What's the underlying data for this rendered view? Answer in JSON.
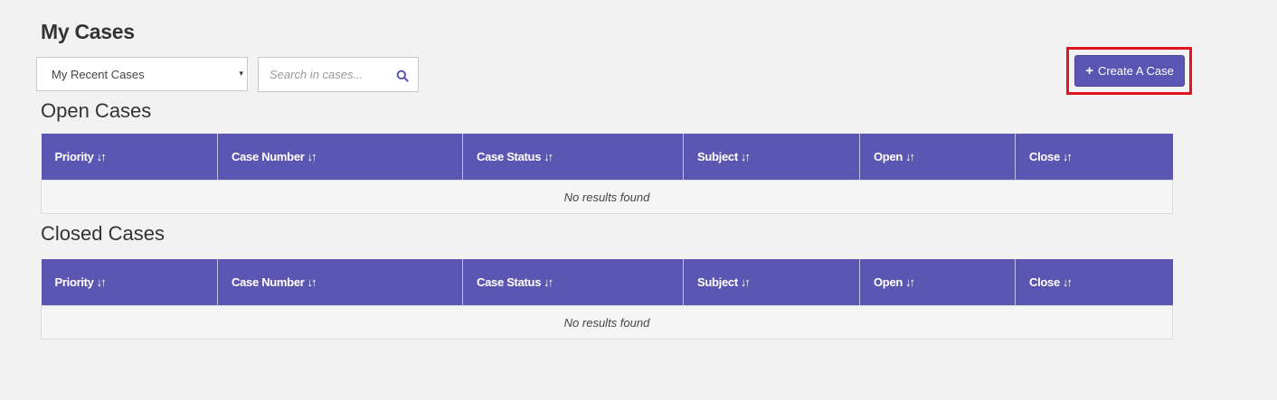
{
  "page_title": "My Cases",
  "filter": {
    "selected": "My Recent Cases",
    "caret": "▾"
  },
  "search": {
    "placeholder": "Search in cases...",
    "icon": "search-icon"
  },
  "create_button": {
    "plus": "+",
    "label": "Create A Case"
  },
  "colors": {
    "accent": "#5c56b3",
    "highlight": "#e0151f",
    "background": "#f2f2f2"
  },
  "open_cases": {
    "title": "Open Cases",
    "columns": [
      {
        "label": "Priority",
        "sort": "↓↑"
      },
      {
        "label": "Case Number",
        "sort": "↓↑"
      },
      {
        "label": "Case Status",
        "sort": "↓↑"
      },
      {
        "label": "Subject",
        "sort": "↓↑"
      },
      {
        "label": "Open",
        "sort": "↓↑"
      },
      {
        "label": "Close",
        "sort": "↓↑"
      }
    ],
    "empty_message": "No results found"
  },
  "closed_cases": {
    "title": "Closed Cases",
    "columns": [
      {
        "label": "Priority",
        "sort": "↓↑"
      },
      {
        "label": "Case Number",
        "sort": "↓↑"
      },
      {
        "label": "Case Status",
        "sort": "↓↑"
      },
      {
        "label": "Subject",
        "sort": "↓↑"
      },
      {
        "label": "Open",
        "sort": "↓↑"
      },
      {
        "label": "Close",
        "sort": "↓↑"
      }
    ],
    "empty_message": "No results found"
  }
}
